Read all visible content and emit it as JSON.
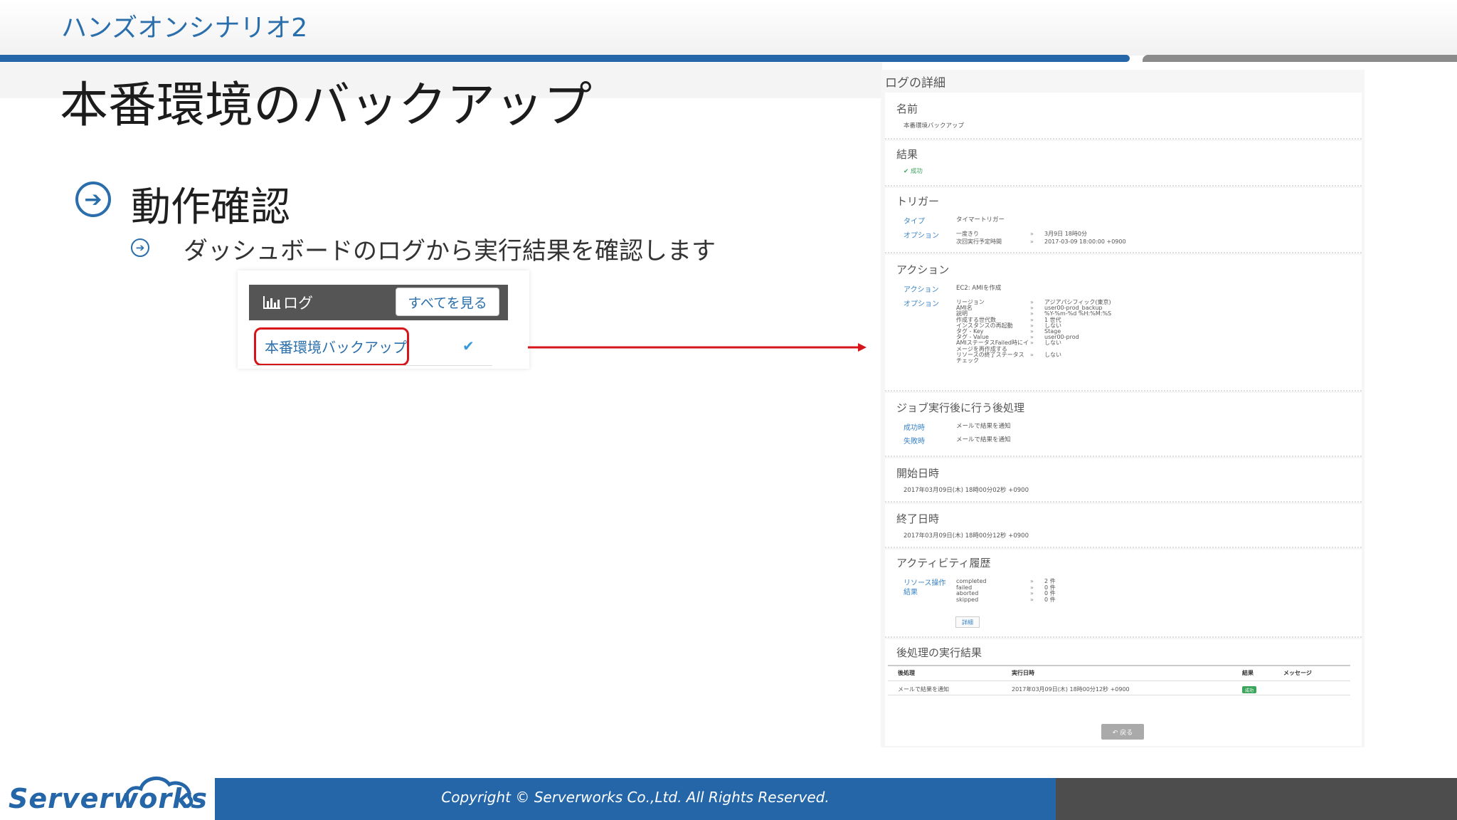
{
  "slide": {
    "deck_title": "ハンズオンシナリオ2",
    "title": "本番環境のバックアップ",
    "bullet1": "動作確認",
    "bullet2": "ダッシュボードのログから実行結果を確認します",
    "icon": "circle-arrow-right-icon"
  },
  "log_widget": {
    "title": "ログ",
    "see_all": "すべてを見る",
    "item": "本番環境バックアップ",
    "item_icon": "checkmark-icon"
  },
  "detail": {
    "title": "ログの詳細",
    "name_label": "名前",
    "name_value": "本番環境バックアップ",
    "result_label": "結果",
    "result_value": "✔ 成功",
    "trigger_label": "トリガー",
    "trigger_type_label": "タイプ",
    "trigger_type_value": "タイマートリガー",
    "trigger_option_label": "オプション",
    "trigger_option_rows": [
      "一度きり",
      "次回実行予定時間"
    ],
    "trigger_option_values": [
      "3月9日 18時0分",
      "2017-03-09 18:00:00 +0900"
    ],
    "action_label": "アクション",
    "action_action_label": "アクション",
    "action_action_value": "EC2: AMIを作成",
    "action_option_label": "オプション",
    "action_option_rows": [
      "リージョン",
      "AMI名",
      "説明",
      "作成する世代数",
      "インスタンスの再起動",
      "タグ - Key",
      "タグ - Value",
      "AMIステータスFailed時にイ",
      "メージを再作成する",
      "リソースの終了ステータス",
      "チェック"
    ],
    "action_option_values": [
      "アジアパシフィック(東京)",
      "user00-prod_backup",
      "%Y-%m-%d %H:%M:%S",
      "1 世代",
      "しない",
      "Stage",
      "user00-prod",
      "しない",
      "",
      "しない",
      ""
    ],
    "post_label": "ジョブ実行後に行う後処理",
    "post_success_label": "成功時",
    "post_success_value": "メールで結果を通知",
    "post_fail_label": "失敗時",
    "post_fail_value": "メールで結果を通知",
    "start_label": "開始日時",
    "start_value": "2017年03月09日(木) 18時00分02秒 +0900",
    "end_label": "終了日時",
    "end_value": "2017年03月09日(木) 18時00分12秒 +0900",
    "activity_label": "アクティビティ履歴",
    "activity_sub_label1": "リソース操作",
    "activity_sub_label2": "結果",
    "activity_rows": [
      "completed",
      "failed",
      "aborted",
      "skipped"
    ],
    "activity_values": [
      "2 件",
      "0 件",
      "0 件",
      "0 件"
    ],
    "detail_button": "詳細",
    "post_result_label": "後処理の実行結果",
    "table_headers": [
      "後処理",
      "実行日時",
      "結果",
      "メッセージ"
    ],
    "table_row": [
      "メールで結果を通知",
      "2017年03月09日(木) 18時00分12秒 +0900",
      "成功",
      ""
    ],
    "back_button": "↶ 戻る"
  },
  "footer": {
    "logo": "Serverworks",
    "copyright": "Copyright ©  Serverworks Co.,Ltd. All Rights Reserved."
  },
  "colors": {
    "brand_blue": "#2466a8",
    "link_blue": "#3a84c6",
    "highlight_red": "#d7141a",
    "success_green": "#3aa55b"
  }
}
